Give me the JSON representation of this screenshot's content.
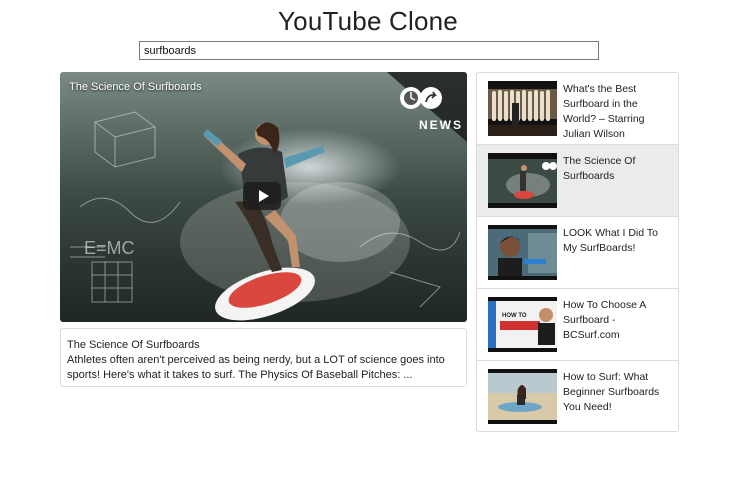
{
  "app": {
    "title": "YouTube Clone"
  },
  "search": {
    "value": "surfboards"
  },
  "player": {
    "video_title": "The Science Of Surfboards",
    "channel_logo_text": "NEWS",
    "play_icon": "play-icon"
  },
  "details": {
    "title": "The Science Of Surfboards",
    "description": "Athletes often aren't perceived as being nerdy, but a LOT of science goes into sports! Here's what it takes to surf. The Physics Of Baseball Pitches: ..."
  },
  "video_list": {
    "items": [
      {
        "title": "What's the Best Surfboard in the World? – Starring Julian Wilson",
        "selected": false
      },
      {
        "title": "The Science Of Surfboards",
        "selected": true
      },
      {
        "title": "LOOK What I Did To My SurfBoards!",
        "selected": false
      },
      {
        "title": "How To Choose A Surfboard - BCSurf.com",
        "selected": false
      },
      {
        "title": "How to Surf: What Beginner Surfboards You Need!",
        "selected": false
      }
    ]
  },
  "colors": {
    "selected_item_bg": "#ececec",
    "border": "#dcdcdc",
    "board_red": "#d9473f"
  }
}
